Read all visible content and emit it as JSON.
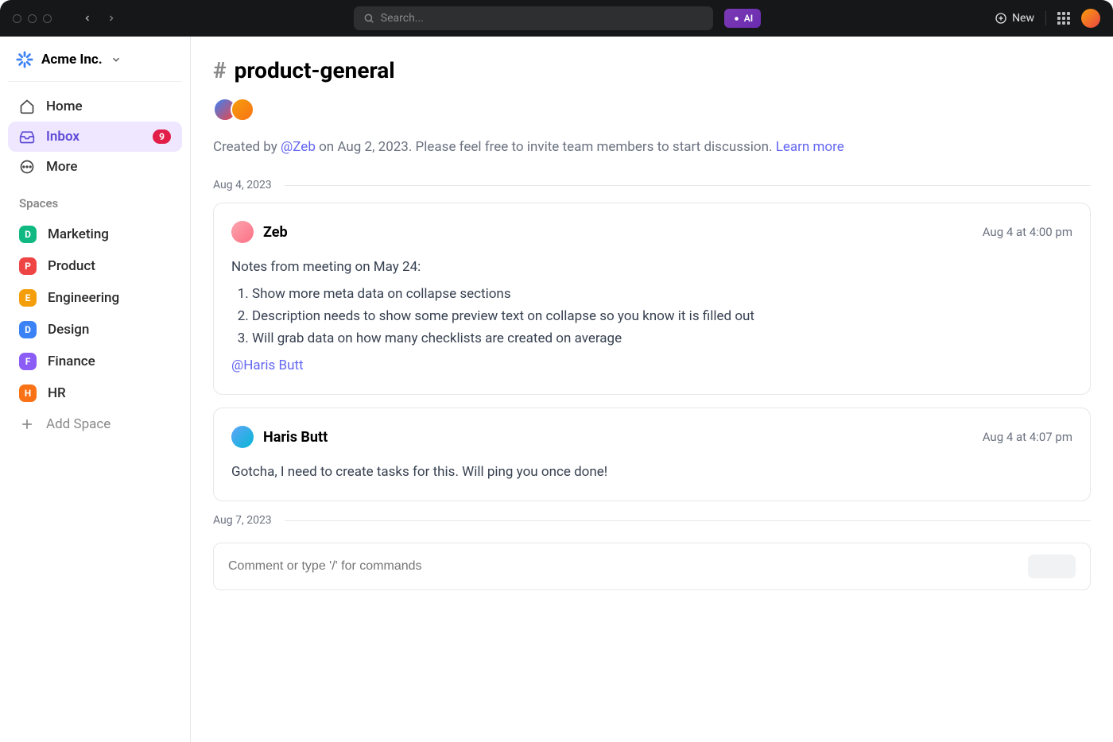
{
  "header": {
    "search_placeholder": "Search...",
    "ai_label": "AI",
    "new_label": "New"
  },
  "workspace": {
    "name": "Acme Inc."
  },
  "nav": {
    "home": "Home",
    "inbox": "Inbox",
    "inbox_count": "9",
    "more": "More"
  },
  "sidebar": {
    "section_label": "Spaces",
    "spaces": [
      {
        "letter": "D",
        "label": "Marketing",
        "color": "#10b981"
      },
      {
        "letter": "P",
        "label": "Product",
        "color": "#ef4444"
      },
      {
        "letter": "E",
        "label": "Engineering",
        "color": "#f59e0b"
      },
      {
        "letter": "D",
        "label": "Design",
        "color": "#3b82f6"
      },
      {
        "letter": "F",
        "label": "Finance",
        "color": "#8b5cf6"
      },
      {
        "letter": "H",
        "label": "HR",
        "color": "#f97316"
      }
    ],
    "add_space": "Add Space"
  },
  "channel": {
    "name": "product-general",
    "created_by_prefix": "Created by ",
    "created_by_mention": "@Zeb",
    "created_by_suffix": " on Aug 2, 2023. Please feel free to invite team members to start discussion. ",
    "learn_more": "Learn more"
  },
  "dates": {
    "d1": "Aug 4, 2023",
    "d2": "Aug 7, 2023"
  },
  "messages": {
    "m1": {
      "author": "Zeb",
      "time": "Aug 4 at 4:00 pm",
      "intro": "Notes from meeting on May 24:",
      "li1": "Show more meta data on collapse sections",
      "li2": "Description needs to show some preview text on collapse so you know it is filled out",
      "li3": "Will grab data on how many checklists are created on average",
      "mention": "@Haris Butt"
    },
    "m2": {
      "author": "Haris Butt",
      "time": "Aug 4 at 4:07 pm",
      "body": "Gotcha, I need to create tasks for this. Will ping you once done!"
    }
  },
  "composer": {
    "placeholder": "Comment or type '/' for commands"
  }
}
